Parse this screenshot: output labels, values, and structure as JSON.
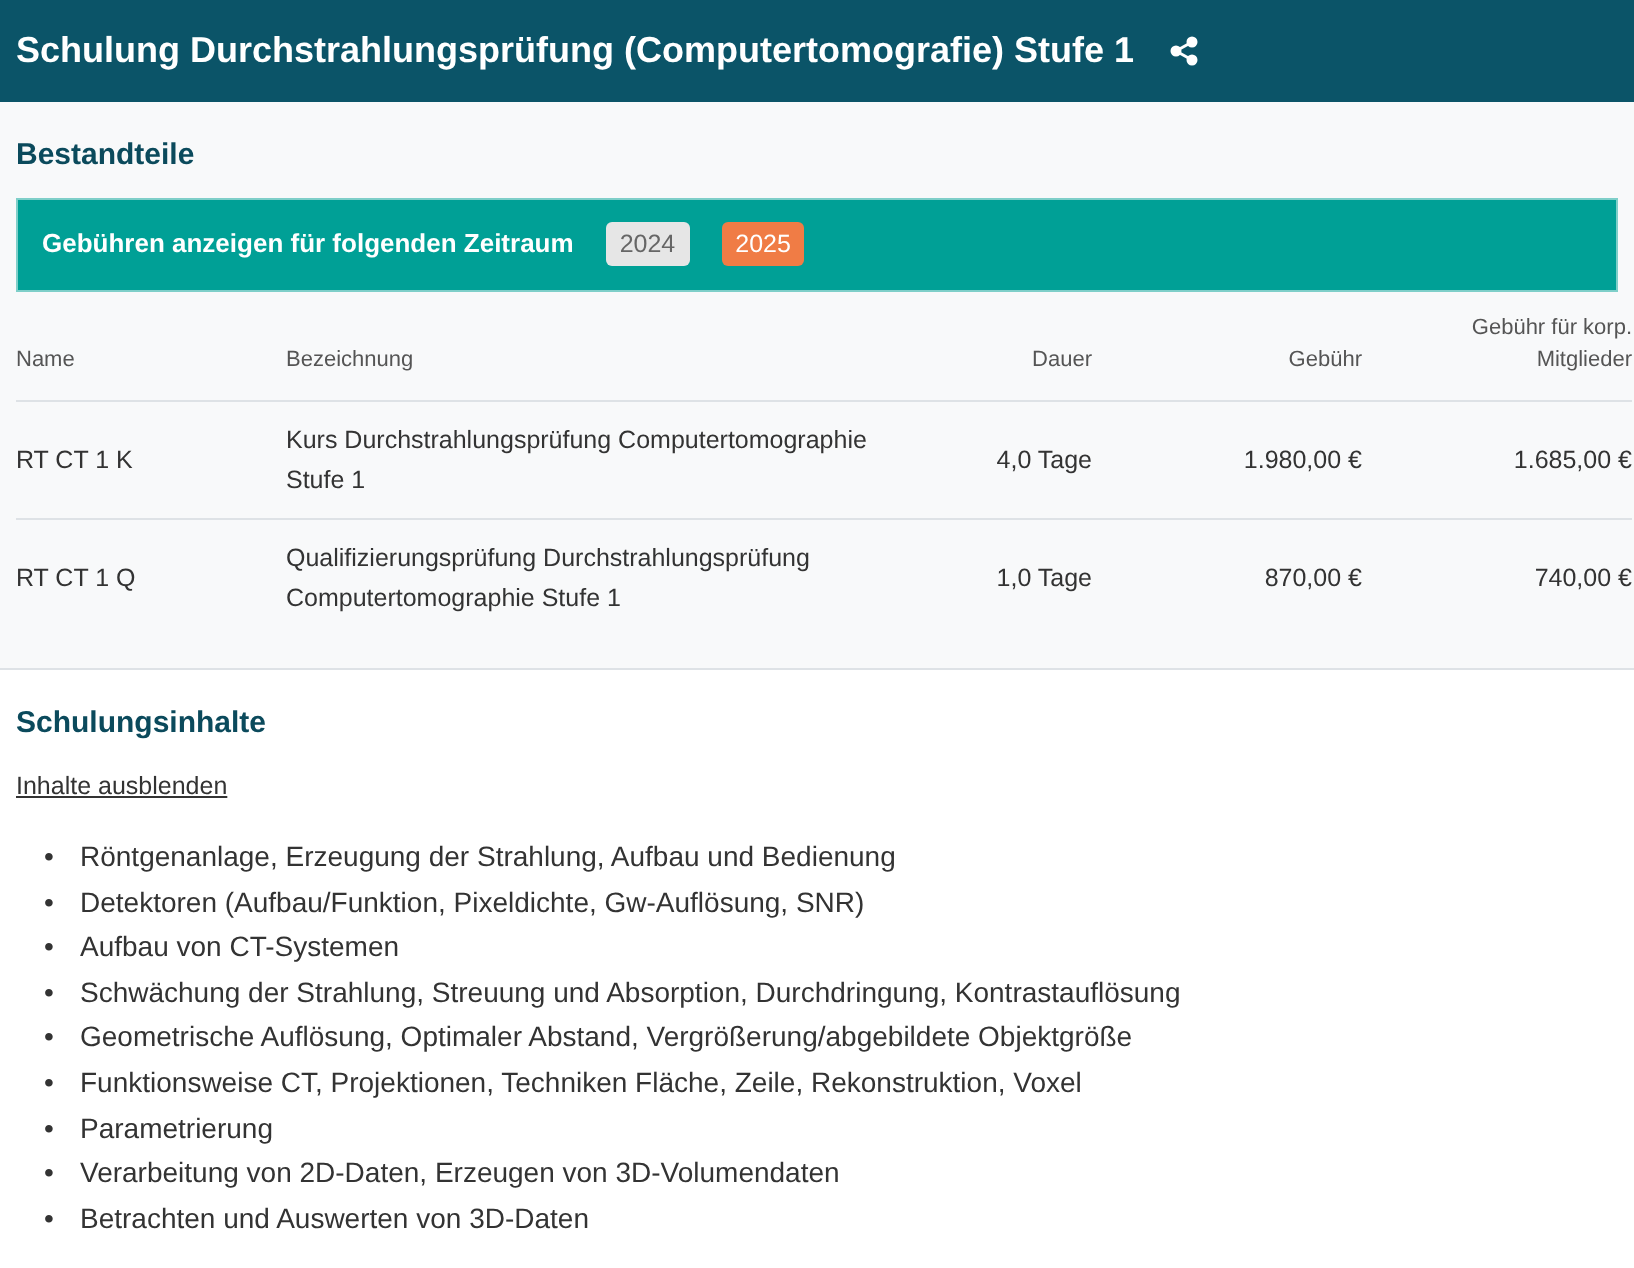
{
  "header": {
    "title": "Schulung Durchstrahlungsprüfung (Computertomografie) Stufe 1"
  },
  "components": {
    "heading": "Bestandteile",
    "period_label": "Gebühren anzeigen für folgenden Zeitraum",
    "years": [
      {
        "label": "2024",
        "selected": false
      },
      {
        "label": "2025",
        "selected": true
      }
    ],
    "table": {
      "columns": [
        "Name",
        "Bezeichnung",
        "Dauer",
        "Gebühr",
        "Gebühr für korp. Mitglieder"
      ],
      "rows": [
        [
          "RT CT 1 K",
          "Kurs Durchstrahlungsprüfung Computertomographie Stufe 1",
          "4,0 Tage",
          "1.980,00 €",
          "1.685,00 €"
        ],
        [
          "RT CT 1 Q",
          "Qualifizierungsprüfung Durchstrahlungsprüfung Computertomographie Stufe 1",
          "1,0 Tage",
          "870,00 €",
          "740,00 €"
        ]
      ]
    }
  },
  "contents": {
    "heading": "Schulungsinhalte",
    "toggle_link": "Inhalte ausblenden",
    "items": [
      {
        "bullet": "•",
        "text": "Röntgenanlage, Erzeugung der Strahlung, Aufbau und Bedienung"
      },
      {
        "bullet": "•",
        "text": "Detektoren (Aufbau/Funktion, Pixeldichte, Gw-Auflösung, SNR)"
      },
      {
        "bullet": "•",
        "text": "Aufbau von CT-Systemen"
      },
      {
        "bullet": "•",
        "text": "Schwächung der Strahlung, Streuung und Absorption, Durchdringung, Kontrastauflösung"
      },
      {
        "bullet": "•",
        "text": "Geometrische Auflösung, Optimaler Abstand, Vergrößerung/abgebildete Objektgröße"
      },
      {
        "bullet": "•",
        "text": "Funktionsweise CT, Projektionen, Techniken Fläche, Zeile, Rekonstruktion, Voxel"
      },
      {
        "bullet": "•",
        "text": "Parametrierung"
      },
      {
        "bullet": "•",
        "text": "Verarbeitung von 2D-Daten, Erzeugen von 3D-Volumendaten"
      },
      {
        "bullet": "•",
        "text": "Betrachten und Auswerten von 3D-Daten"
      }
    ]
  }
}
